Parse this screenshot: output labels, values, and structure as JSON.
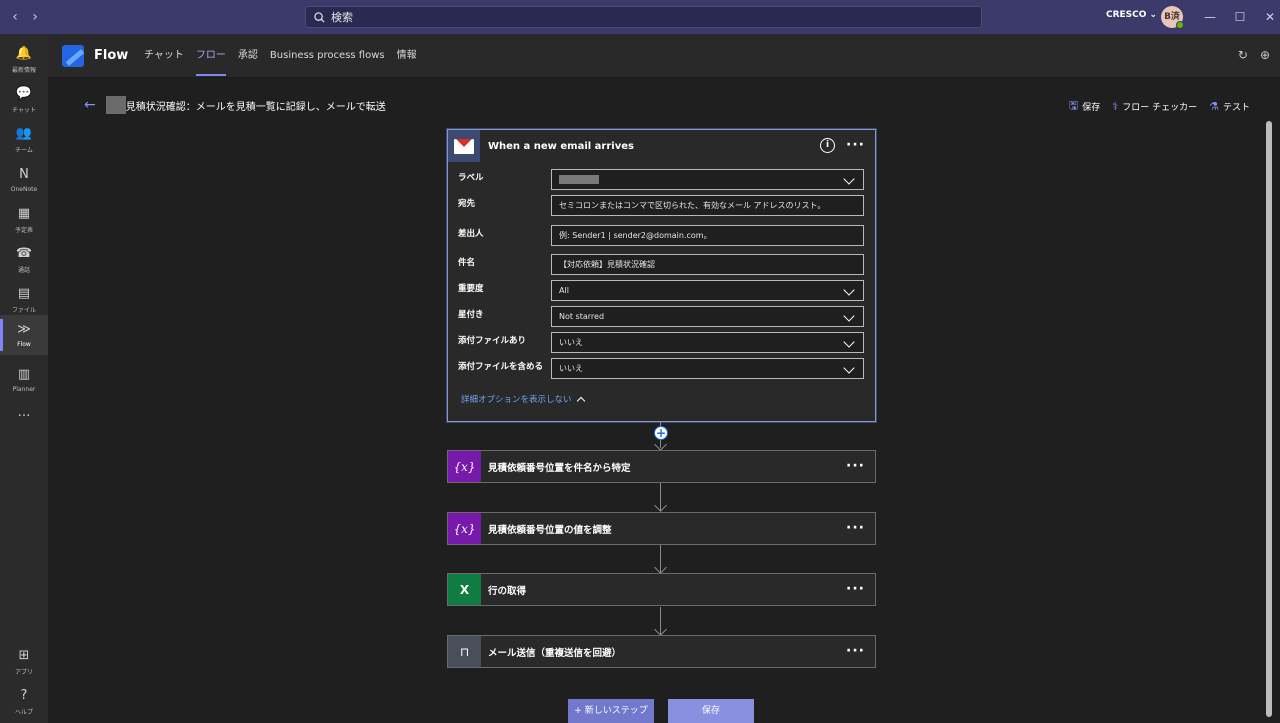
{
  "titlebar": {
    "search_placeholder": "検索",
    "org": "CRESCO ⌄",
    "avatar_initials": "B済"
  },
  "rail": {
    "items": [
      {
        "label": "最新情報",
        "icon": "bell-icon",
        "glyph": "🔔"
      },
      {
        "label": "チャット",
        "icon": "chat-icon",
        "glyph": "💬"
      },
      {
        "label": "チーム",
        "icon": "teams-icon",
        "glyph": "👥"
      },
      {
        "label": "OneNote",
        "icon": "onenote-icon",
        "glyph": "N"
      },
      {
        "label": "予定表",
        "icon": "calendar-icon",
        "glyph": "▦"
      },
      {
        "label": "通話",
        "icon": "phone-icon",
        "glyph": "☎"
      },
      {
        "label": "ファイル",
        "icon": "file-icon",
        "glyph": "▤"
      },
      {
        "label": "Flow",
        "icon": "flow-icon",
        "glyph": "≫"
      },
      {
        "label": "Planner",
        "icon": "planner-icon",
        "glyph": "▥"
      }
    ],
    "more": "…",
    "apps_label": "アプリ",
    "help_label": "ヘルプ"
  },
  "apphead": {
    "title": "Flow",
    "tabs": [
      "チャット",
      "フロー",
      "承認",
      "Business process flows",
      "情報"
    ],
    "active_tab": 1
  },
  "breadcrumb": {
    "flow_name": "見積状況確認：メールを見積一覧に記録し、メールで転送"
  },
  "toolbar": {
    "save": "保存",
    "checker": "フロー チェッカー",
    "test": "テスト"
  },
  "trigger": {
    "title": "When a new email arrives",
    "fields": [
      {
        "label": "ラベル",
        "value": "",
        "redacted": true,
        "dropdown": true
      },
      {
        "label": "宛先",
        "value": "セミコロンまたはコンマで区切られた、有効なメール アドレスのリスト。",
        "dropdown": false
      },
      {
        "label": "差出人",
        "value": "例: Sender1 | sender2@domain.com。",
        "dropdown": false
      },
      {
        "label": "件名",
        "value": "【対応依頼】見積状況確認",
        "dropdown": false
      },
      {
        "label": "重要度",
        "value": "All",
        "dropdown": true
      },
      {
        "label": "星付き",
        "value": "Not starred",
        "dropdown": true
      },
      {
        "label": "添付ファイルあり",
        "value": "いいえ",
        "dropdown": true
      },
      {
        "label": "添付ファイルを含める",
        "value": "いいえ",
        "dropdown": true
      }
    ],
    "advanced_toggle": "詳細オプションを表示しない"
  },
  "steps": [
    {
      "label": "見積依頼番号位置を件名から特定",
      "icon": "variable-icon",
      "glyph": "{x}",
      "color": "#7719aa"
    },
    {
      "label": "見積依頼番号位置の値を調整",
      "icon": "variable-icon",
      "glyph": "{x}",
      "color": "#7719aa"
    },
    {
      "label": "行の取得",
      "icon": "excel-icon",
      "glyph": "X",
      "color": "#107c41"
    },
    {
      "label": "メール送信（重複送信を回避）",
      "icon": "condition-icon",
      "glyph": "⊓",
      "color": "#484f58"
    }
  ],
  "buttons": {
    "new_step": "+ 新しいステップ",
    "save": "保存"
  }
}
